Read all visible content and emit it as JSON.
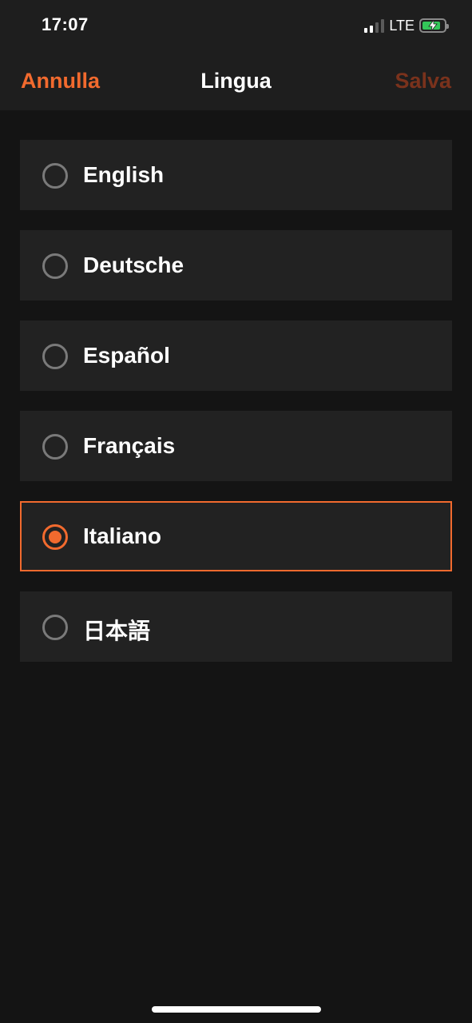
{
  "status_bar": {
    "time": "17:07",
    "network": "LTE",
    "signal_bars_active": 2,
    "signal_bars_total": 4,
    "battery_level": 0.85,
    "battery_charging": true,
    "battery_color": "#34c759"
  },
  "nav": {
    "cancel_label": "Annulla",
    "title": "Lingua",
    "save_label": "Salva",
    "cancel_color": "#f26a2e",
    "save_color": "#7a321c"
  },
  "languages": [
    {
      "label": "English",
      "selected": false
    },
    {
      "label": "Deutsche",
      "selected": false
    },
    {
      "label": "Español",
      "selected": false
    },
    {
      "label": "Français",
      "selected": false
    },
    {
      "label": "Italiano",
      "selected": true
    },
    {
      "label": "日本語",
      "selected": false
    }
  ],
  "colors": {
    "accent": "#f26a2e",
    "background": "#141414",
    "row_background": "#222222",
    "header_background": "#1e1e1e",
    "radio_unselected": "#7a7a7a"
  },
  "icons": {
    "signal": "cellular-signal-icon",
    "battery": "battery-charging-icon",
    "radio_on": "radio-selected-icon",
    "radio_off": "radio-unselected-icon"
  }
}
